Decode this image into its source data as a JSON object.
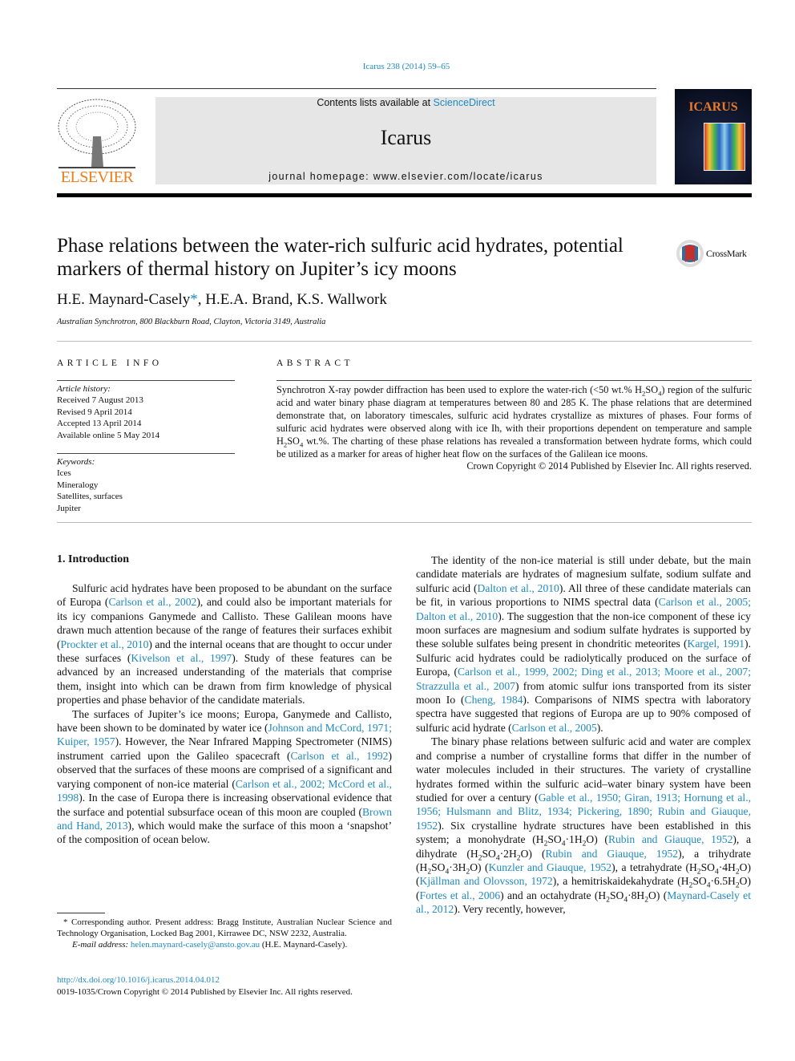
{
  "header": {
    "citation": "Icarus 238 (2014) 59–65",
    "contents_prefix": "Contents lists available at ",
    "contents_link": "ScienceDirect",
    "journal": "Icarus",
    "homepage": "journal homepage: www.elsevier.com/locate/icarus",
    "publisher_logo": "ELSEVIER",
    "cover_title": "ICARUS",
    "colors": {
      "link": "#1f8ac0",
      "elsevier_orange": "#f07c1a",
      "banner_bg": "#e6e6e6"
    }
  },
  "article": {
    "title": "Phase relations between the water-rich sulfuric acid hydrates, potential markers of thermal history on Jupiter’s icy moons",
    "crossmark": "CrossMark",
    "authors_1": "H.E. Maynard-Casely",
    "author_mark": "*",
    "authors_2": ", H.E.A. Brand, K.S. Wallwork",
    "affiliation": "Australian Synchrotron, 800 Blackburn Road, Clayton, Victoria 3149, Australia"
  },
  "article_info": {
    "heading": "ARTICLE INFO",
    "history_label": "Article history:",
    "history": [
      "Received 7 August 2013",
      "Revised 9 April 2014",
      "Accepted 13 April 2014",
      "Available online 5 May 2014"
    ],
    "keywords_label": "Keywords:",
    "keywords": [
      "Ices",
      "Mineralogy",
      "Satellites, surfaces",
      "Jupiter"
    ]
  },
  "abstract": {
    "heading": "ABSTRACT",
    "segments": [
      {
        "t": "Synchrotron X-ray powder diffraction has been used to explore the water-rich (<50 wt.% H"
      },
      {
        "s": "2"
      },
      {
        "t": "SO"
      },
      {
        "s": "4"
      },
      {
        "t": ") region of the sulfuric acid and water binary phase diagram at temperatures between 80 and 285 K. The phase relations that are determined demonstrate that, on laboratory timescales, sulfuric acid hydrates crystallize as mixtures of phases. Four forms of sulfuric acid hydrates were observed along with ice Ih, with their proportions dependent on temperature and sample H"
      },
      {
        "s": "2"
      },
      {
        "t": "SO"
      },
      {
        "s": "4"
      },
      {
        "t": " wt.%. The charting of these phase relations has revealed a transformation between hydrate forms, which could be utilized as a marker for areas of higher heat flow on the surfaces of the Galilean ice moons."
      }
    ],
    "copyright": "Crown Copyright © 2014 Published by Elsevier Inc. All rights reserved."
  },
  "body": {
    "section_heading": "1. Introduction",
    "left_paragraphs": [
      [
        {
          "t": "Sulfuric acid hydrates have been proposed to be abundant on the surface of Europa ("
        },
        {
          "l": "Carlson et al., 2002"
        },
        {
          "t": "), and could also be important materials for its icy companions Ganymede and Callisto. These Galilean moons have drawn much attention because of the range of features their surfaces exhibit ("
        },
        {
          "l": "Prockter et al., 2010"
        },
        {
          "t": ") and the internal oceans that are thought to occur under these surfaces ("
        },
        {
          "l": "Kivelson et al., 1997"
        },
        {
          "t": "). Study of these features can be advanced by an increased understanding of the materials that comprise them, insight into which can be drawn from firm knowledge of physical properties and phase behavior of the candidate materials."
        }
      ],
      [
        {
          "t": "The surfaces of Jupiter’s ice moons; Europa, Ganymede and Callisto, have been shown to be dominated by water ice ("
        },
        {
          "l": "Johnson and McCord, 1971; Kuiper, 1957"
        },
        {
          "t": "). However, the Near Infrared Mapping Spectrometer (NIMS) instrument carried upon the Galileo spacecraft ("
        },
        {
          "l": "Carlson et al., 1992"
        },
        {
          "t": ") observed that the surfaces of these moons are comprised of a significant and varying component of non-ice material ("
        },
        {
          "l": "Carlson et al., 2002; McCord et al., 1998"
        },
        {
          "t": "). In the case of Europa there is increasing observational evidence that the surface and potential subsurface ocean of this moon are coupled ("
        },
        {
          "l": "Brown and Hand, 2013"
        },
        {
          "t": "), which would make the surface of this moon a ‘snapshot’ of the composition of ocean below."
        }
      ]
    ],
    "right_paragraphs": [
      [
        {
          "t": "The identity of the non-ice material is still under debate, but the main candidate materials are hydrates of magnesium sulfate, sodium sulfate and sulfuric acid ("
        },
        {
          "l": "Dalton et al., 2010"
        },
        {
          "t": "). All three of these candidate materials can be fit, in various proportions to NIMS spectral data ("
        },
        {
          "l": "Carlson et al., 2005; Dalton et al., 2010"
        },
        {
          "t": "). The suggestion that the non-ice component of these icy moon surfaces are magnesium and sodium sulfate hydrates is supported by these soluble sulfates being present in chondritic meteorites ("
        },
        {
          "l": "Kargel, 1991"
        },
        {
          "t": "). Sulfuric acid hydrates could be radiolytically produced on the surface of Europa, ("
        },
        {
          "l": "Carlson et al., 1999, 2002; Ding et al., 2013; Moore et al., 2007; Strazzulla et al., 2007"
        },
        {
          "t": ") from atomic sulfur ions transported from its sister moon Io ("
        },
        {
          "l": "Cheng, 1984"
        },
        {
          "t": "). Comparisons of NIMS spectra with laboratory spectra have suggested that regions of Europa are up to 90% composed of sulfuric acid hydrate ("
        },
        {
          "l": "Carlson et al., 2005"
        },
        {
          "t": ")."
        }
      ],
      [
        {
          "t": "The binary phase relations between sulfuric acid and water are complex and comprise a number of crystalline forms that differ in the number of water molecules included in their structures. The variety of crystalline hydrates formed within the sulfuric acid–water binary system have been studied for over a century ("
        },
        {
          "l": "Gable et al., 1950; Giran, 1913; Hornung et al., 1956; Hulsmann and Blitz, 1934; Pickering, 1890; Rubin and Giauque, 1952"
        },
        {
          "t": "). Six crystalline hydrate structures have been established in this system; a monohydrate (H"
        },
        {
          "s": "2"
        },
        {
          "t": "SO"
        },
        {
          "s": "4"
        },
        {
          "t": "·1H"
        },
        {
          "s": "2"
        },
        {
          "t": "O) ("
        },
        {
          "l": "Rubin and Giauque, 1952"
        },
        {
          "t": "), a dihydrate (H"
        },
        {
          "s": "2"
        },
        {
          "t": "SO"
        },
        {
          "s": "4"
        },
        {
          "t": "·2H"
        },
        {
          "s": "2"
        },
        {
          "t": "O) ("
        },
        {
          "l": "Rubin and Giauque, 1952"
        },
        {
          "t": "), a trihydrate (H"
        },
        {
          "s": "2"
        },
        {
          "t": "SO"
        },
        {
          "s": "4"
        },
        {
          "t": "·3H"
        },
        {
          "s": "2"
        },
        {
          "t": "O) ("
        },
        {
          "l": "Kunzler and Giauque, 1952"
        },
        {
          "t": "), a tetrahydrate (H"
        },
        {
          "s": "2"
        },
        {
          "t": "SO"
        },
        {
          "s": "4"
        },
        {
          "t": "·4H"
        },
        {
          "s": "2"
        },
        {
          "t": "O) ("
        },
        {
          "l": "Kjällman and Olovsson, 1972"
        },
        {
          "t": "), a hemitriskaidekahydrate (H"
        },
        {
          "s": "2"
        },
        {
          "t": "SO"
        },
        {
          "s": "4"
        },
        {
          "t": "·6.5H"
        },
        {
          "s": "2"
        },
        {
          "t": "O) ("
        },
        {
          "l": "Fortes et al., 2006"
        },
        {
          "t": ") and an octahydrate (H"
        },
        {
          "s": "2"
        },
        {
          "t": "SO"
        },
        {
          "s": "4"
        },
        {
          "t": "·8H"
        },
        {
          "s": "2"
        },
        {
          "t": "O) ("
        },
        {
          "l": "Maynard-Casely et al., 2012"
        },
        {
          "t": "). Very recently, however,"
        }
      ]
    ]
  },
  "footer": {
    "footnote": "* Corresponding author. Present address: Bragg Institute, Australian Nuclear Science and Technology Organisation, Locked Bag 2001, Kirrawee DC, NSW 2232, Australia.",
    "email_label": "E-mail address: ",
    "email": "helen.maynard-casely@ansto.gov.au",
    "email_suffix": " (H.E. Maynard-Casely).",
    "doi": "http://dx.doi.org/10.1016/j.icarus.2014.04.012",
    "issn": "0019-1035/Crown Copyright © 2014 Published by Elsevier Inc. All rights reserved."
  }
}
